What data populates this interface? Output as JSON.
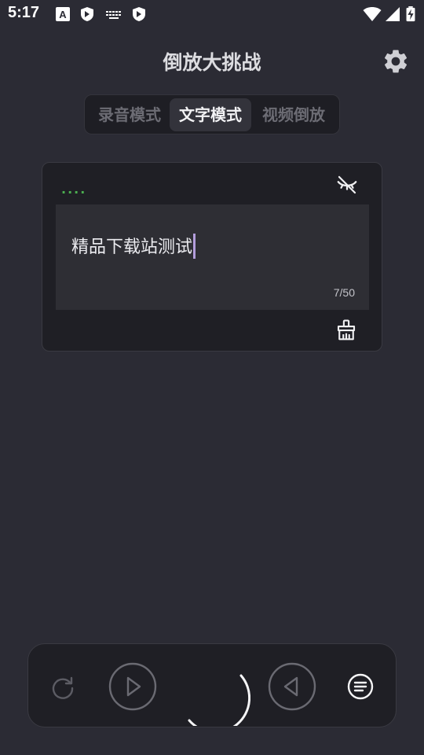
{
  "status_bar": {
    "time": "5:17",
    "left_icons": [
      "a-badge-icon",
      "shield-icon",
      "keyboard-icon",
      "shield-icon"
    ],
    "right_icons": [
      "wifi-icon",
      "signal-icon",
      "battery-charging-icon"
    ]
  },
  "header": {
    "title": "倒放大挑战",
    "settings_icon": "gear-icon"
  },
  "tabs": [
    {
      "label": "录音模式",
      "active": false
    },
    {
      "label": "文字模式",
      "active": true
    },
    {
      "label": "视频倒放",
      "active": false
    }
  ],
  "text_card": {
    "status_dots": "····",
    "status_color": "#4caf50",
    "visibility_icon": "eye-off-icon",
    "input_value": "精品下载站测试",
    "char_count": "7/50",
    "clear_icon": "broom-icon"
  },
  "controls": {
    "icons": [
      "redo-icon",
      "play-icon",
      "record-icon",
      "reverse-play-icon",
      "list-menu-icon"
    ]
  },
  "colors": {
    "background": "#2b2b34",
    "card": "#1f1f25",
    "accent_green": "#4caf50",
    "caret": "#b39ddb"
  }
}
